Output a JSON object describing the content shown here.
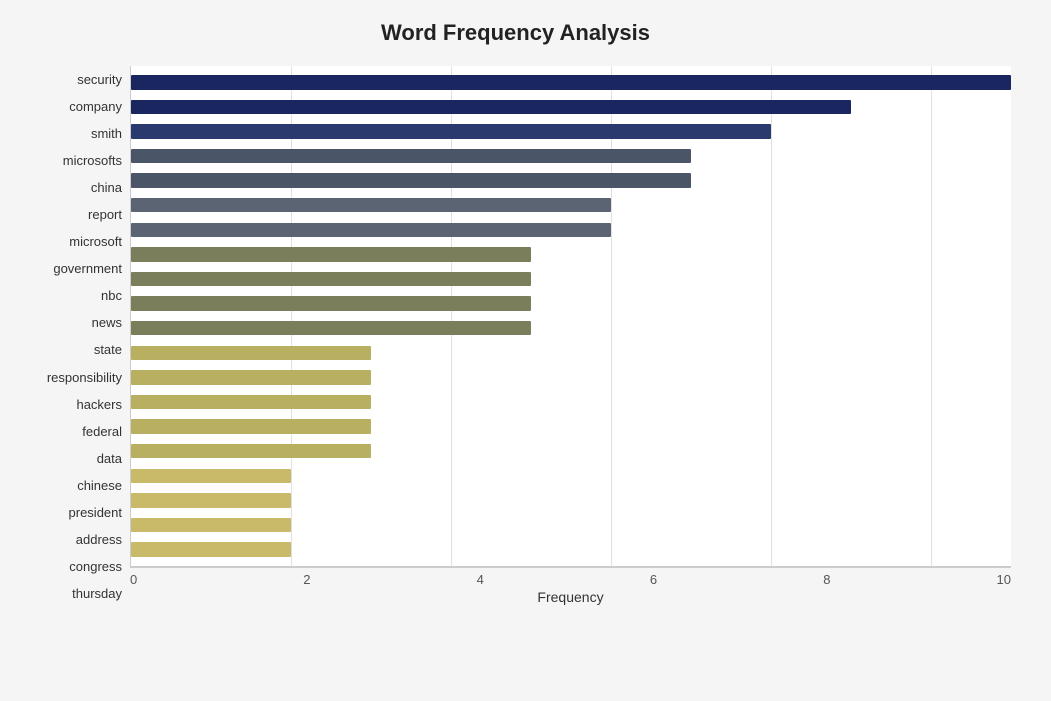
{
  "title": "Word Frequency Analysis",
  "xAxisLabel": "Frequency",
  "xTicks": [
    "0",
    "2",
    "4",
    "6",
    "8",
    "10"
  ],
  "maxValue": 11,
  "bars": [
    {
      "label": "security",
      "value": 11,
      "color": "#1a2660"
    },
    {
      "label": "company",
      "value": 9,
      "color": "#1a2660"
    },
    {
      "label": "smith",
      "value": 8,
      "color": "#2b3a6e"
    },
    {
      "label": "microsofts",
      "value": 7,
      "color": "#4a5568"
    },
    {
      "label": "china",
      "value": 7,
      "color": "#4a5568"
    },
    {
      "label": "report",
      "value": 6,
      "color": "#5a6472"
    },
    {
      "label": "microsoft",
      "value": 6,
      "color": "#5a6472"
    },
    {
      "label": "government",
      "value": 5,
      "color": "#7a7e5a"
    },
    {
      "label": "nbc",
      "value": 5,
      "color": "#7a7e5a"
    },
    {
      "label": "news",
      "value": 5,
      "color": "#7a7e5a"
    },
    {
      "label": "state",
      "value": 5,
      "color": "#7a7e5a"
    },
    {
      "label": "responsibility",
      "value": 3,
      "color": "#b8b060"
    },
    {
      "label": "hackers",
      "value": 3,
      "color": "#b8b060"
    },
    {
      "label": "federal",
      "value": 3,
      "color": "#b8b060"
    },
    {
      "label": "data",
      "value": 3,
      "color": "#b8b060"
    },
    {
      "label": "chinese",
      "value": 3,
      "color": "#b8b060"
    },
    {
      "label": "president",
      "value": 2,
      "color": "#c8ba68"
    },
    {
      "label": "address",
      "value": 2,
      "color": "#c8ba68"
    },
    {
      "label": "congress",
      "value": 2,
      "color": "#c8ba68"
    },
    {
      "label": "thursday",
      "value": 2,
      "color": "#c8ba68"
    }
  ]
}
